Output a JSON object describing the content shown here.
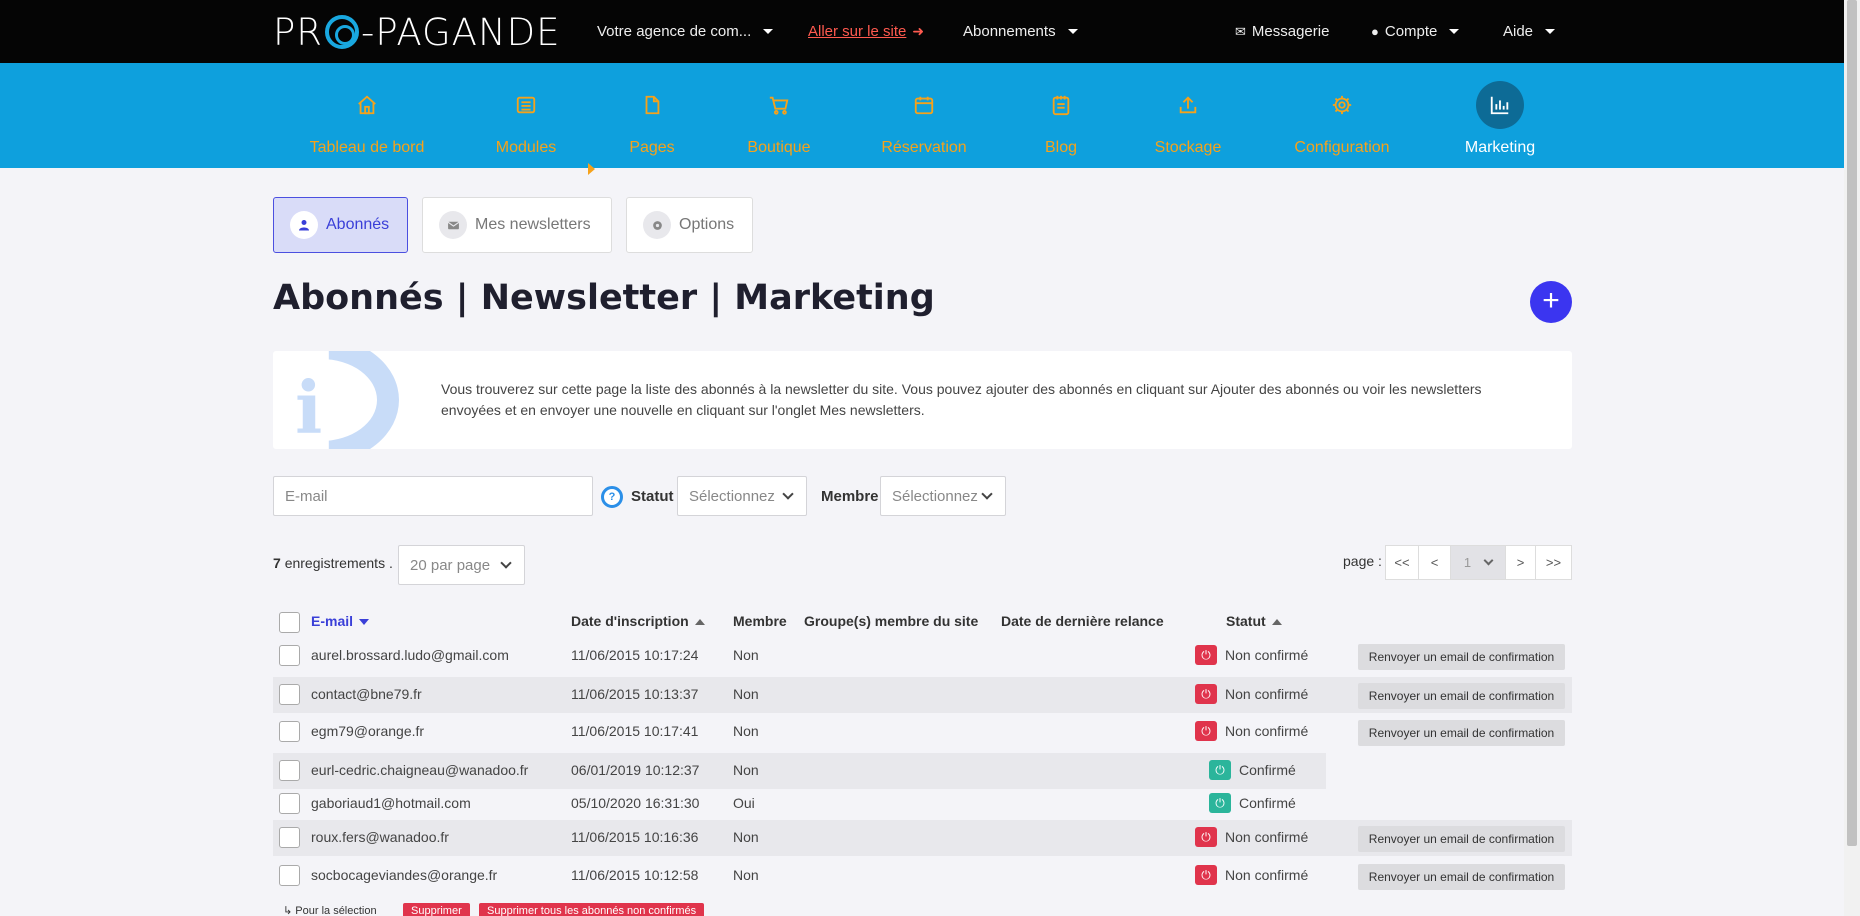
{
  "topbar": {
    "logo_left": "PR",
    "logo_right": "-PAGANDE",
    "agency": "Votre agence de com...",
    "visit_site": "Aller sur le site",
    "subscriptions": "Abonnements",
    "messages": "Messagerie",
    "account": "Compte",
    "help": "Aide"
  },
  "nav": {
    "items": [
      {
        "label": "Tableau de bord",
        "icon": "home-icon"
      },
      {
        "label": "Modules",
        "icon": "list-icon"
      },
      {
        "label": "Pages",
        "icon": "page-icon"
      },
      {
        "label": "Boutique",
        "icon": "cart-icon"
      },
      {
        "label": "Réservation",
        "icon": "calendar-icon"
      },
      {
        "label": "Blog",
        "icon": "notepad-icon"
      },
      {
        "label": "Stockage",
        "icon": "upload-icon"
      },
      {
        "label": "Configuration",
        "icon": "gear-icon"
      },
      {
        "label": "Marketing",
        "icon": "chart-icon"
      }
    ],
    "active": "Marketing"
  },
  "tabs": [
    {
      "label": "Abonnés",
      "icon": "user-icon"
    },
    {
      "label": "Mes newsletters",
      "icon": "envelope-icon"
    },
    {
      "label": "Options",
      "icon": "gear-icon"
    }
  ],
  "page_title": "Abonnés | Newsletter | Marketing",
  "add_button": "+",
  "info": {
    "icon_letter": "i",
    "text": "Vous trouverez sur cette page la liste des abonnés à la newsletter du site. Vous pouvez ajouter des abonnés en cliquant sur Ajouter des abonnés ou voir les newsletters envoyées et en envoyer une nouvelle en cliquant sur l'onglet Mes newsletters."
  },
  "filters": {
    "email_placeholder": "E-mail",
    "status_label": "Statut",
    "status_value": "Sélectionnez",
    "member_label": "Membre",
    "member_value": "Sélectionnez",
    "help_glyph": "?"
  },
  "records": {
    "count": "7",
    "suffix": "enregistrements .",
    "per_page": "20 par page"
  },
  "pager": {
    "label": "page :",
    "first": "<<",
    "prev": "<",
    "current": "1",
    "next": ">",
    "last": ">>"
  },
  "table": {
    "headers": {
      "email": "E-mail",
      "date": "Date d'inscription",
      "member": "Membre",
      "groups": "Groupe(s) membre du site",
      "last_reminder": "Date de dernière relance",
      "status": "Statut"
    },
    "resend_label": "Renvoyer un email de confirmation",
    "rows": [
      {
        "email": "aurel.brossard.ludo@gmail.com",
        "date": "11/06/2015 10:17:24",
        "member": "Non",
        "status": "Non confirmé"
      },
      {
        "email": "contact@bne79.fr",
        "date": "11/06/2015 10:13:37",
        "member": "Non",
        "status": "Non confirmé"
      },
      {
        "email": "egm79@orange.fr",
        "date": "11/06/2015 10:17:41",
        "member": "Non",
        "status": "Non confirmé"
      },
      {
        "email": "eurl-cedric.chaigneau@wanadoo.fr",
        "date": "06/01/2019 10:12:37",
        "member": "Non",
        "status": "Confirmé"
      },
      {
        "email": "gaboriaud1@hotmail.com",
        "date": "05/10/2020 16:31:30",
        "member": "Oui",
        "status": "Confirmé"
      },
      {
        "email": "roux.fers@wanadoo.fr",
        "date": "11/06/2015 10:16:36",
        "member": "Non",
        "status": "Non confirmé"
      },
      {
        "email": "socbocageviandes@orange.fr",
        "date": "11/06/2015 10:12:58",
        "member": "Non",
        "status": "Non confirmé"
      }
    ]
  },
  "bulk": {
    "label": "Pour la sélection",
    "delete": "Supprimer",
    "delete_unconfirmed": "Supprimer tous les abonnés non confirmés"
  },
  "colors": {
    "nav_bg": "#0ea0dd",
    "nav_text": "#f6a21a",
    "accent": "#3b35f0",
    "danger": "#e0344c",
    "success": "#2bb59b"
  }
}
